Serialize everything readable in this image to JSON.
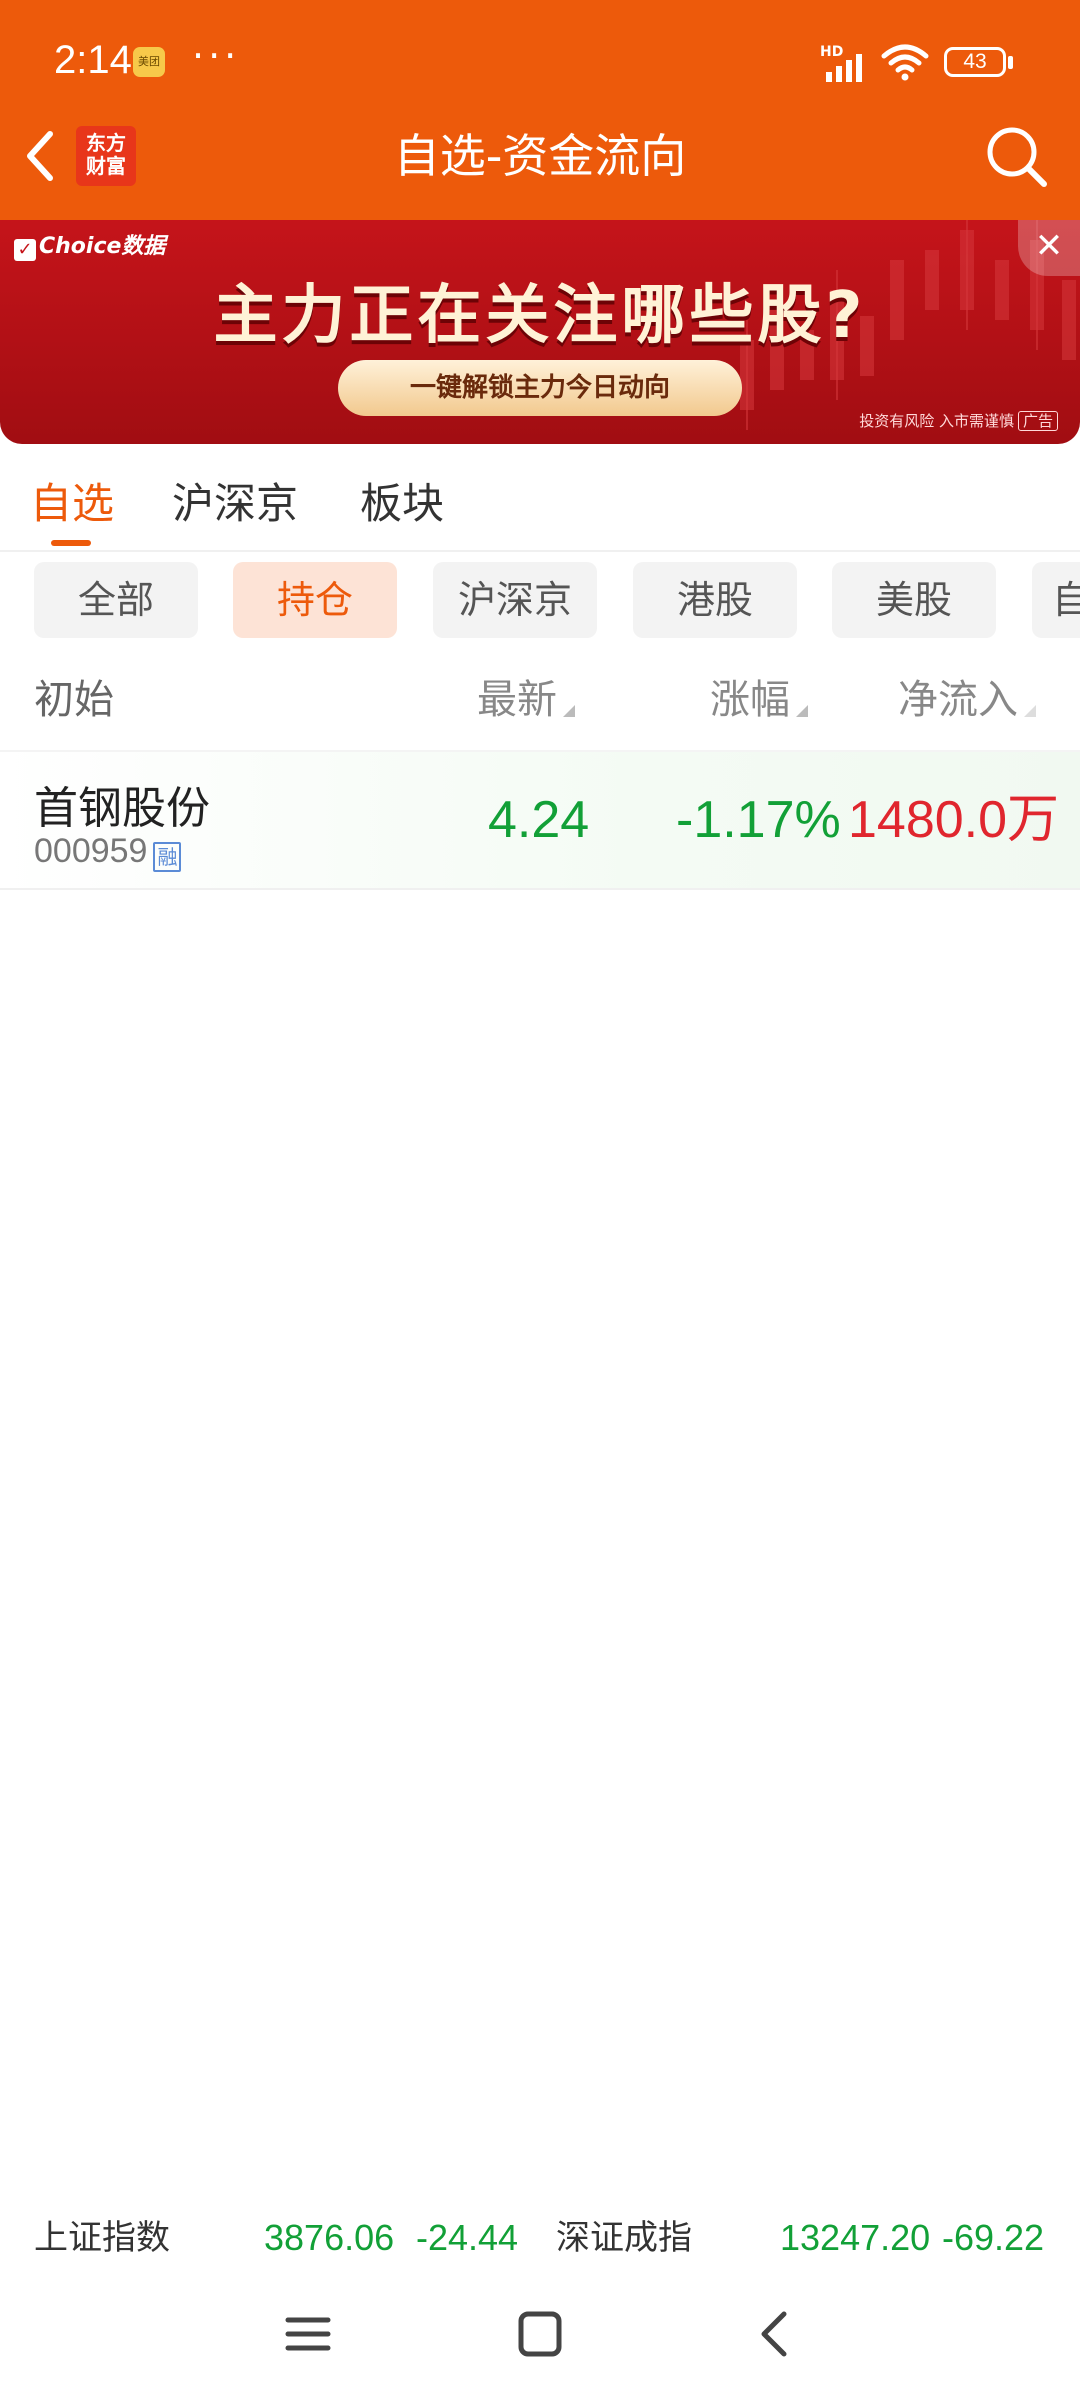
{
  "status_bar": {
    "time": "2:14",
    "app_badge": "美团",
    "more": "···",
    "network": "HD",
    "battery": "43"
  },
  "header": {
    "logo_text_line1": "东方",
    "logo_text_line2": "财富",
    "title": "自选-资金流向"
  },
  "banner": {
    "brand": "Choice数据",
    "headline": "主力正在关注哪些股?",
    "cta": "一键解锁主力今日动向",
    "disclaimer": "投资有风险 入市需谨慎",
    "ad_tag": "广告",
    "close": "✕"
  },
  "tabs": [
    {
      "label": "自选"
    },
    {
      "label": "沪深京"
    },
    {
      "label": "板块"
    }
  ],
  "filters": [
    {
      "label": "全部"
    },
    {
      "label": "持仓"
    },
    {
      "label": "沪深京"
    },
    {
      "label": "港股"
    },
    {
      "label": "美股"
    },
    {
      "label": "自"
    }
  ],
  "table": {
    "columns": {
      "name": "初始",
      "latest": "最新",
      "change": "涨幅",
      "net_inflow": "净流入"
    },
    "rows": [
      {
        "name": "首钢股份",
        "code": "000959",
        "margin_badge": "融",
        "latest": "4.24",
        "change": "-1.17%",
        "net_inflow": "1480.0万"
      }
    ]
  },
  "ticker": {
    "sh_label": "上证指数",
    "sh_value": "3876.06",
    "sh_change": "-24.44",
    "sz_label": "深证成指",
    "sz_value": "13247.20",
    "sz_change": "-69.22"
  },
  "colors": {
    "brand": "#ED5A0B",
    "down": "#12A037",
    "up": "#E0262E"
  }
}
